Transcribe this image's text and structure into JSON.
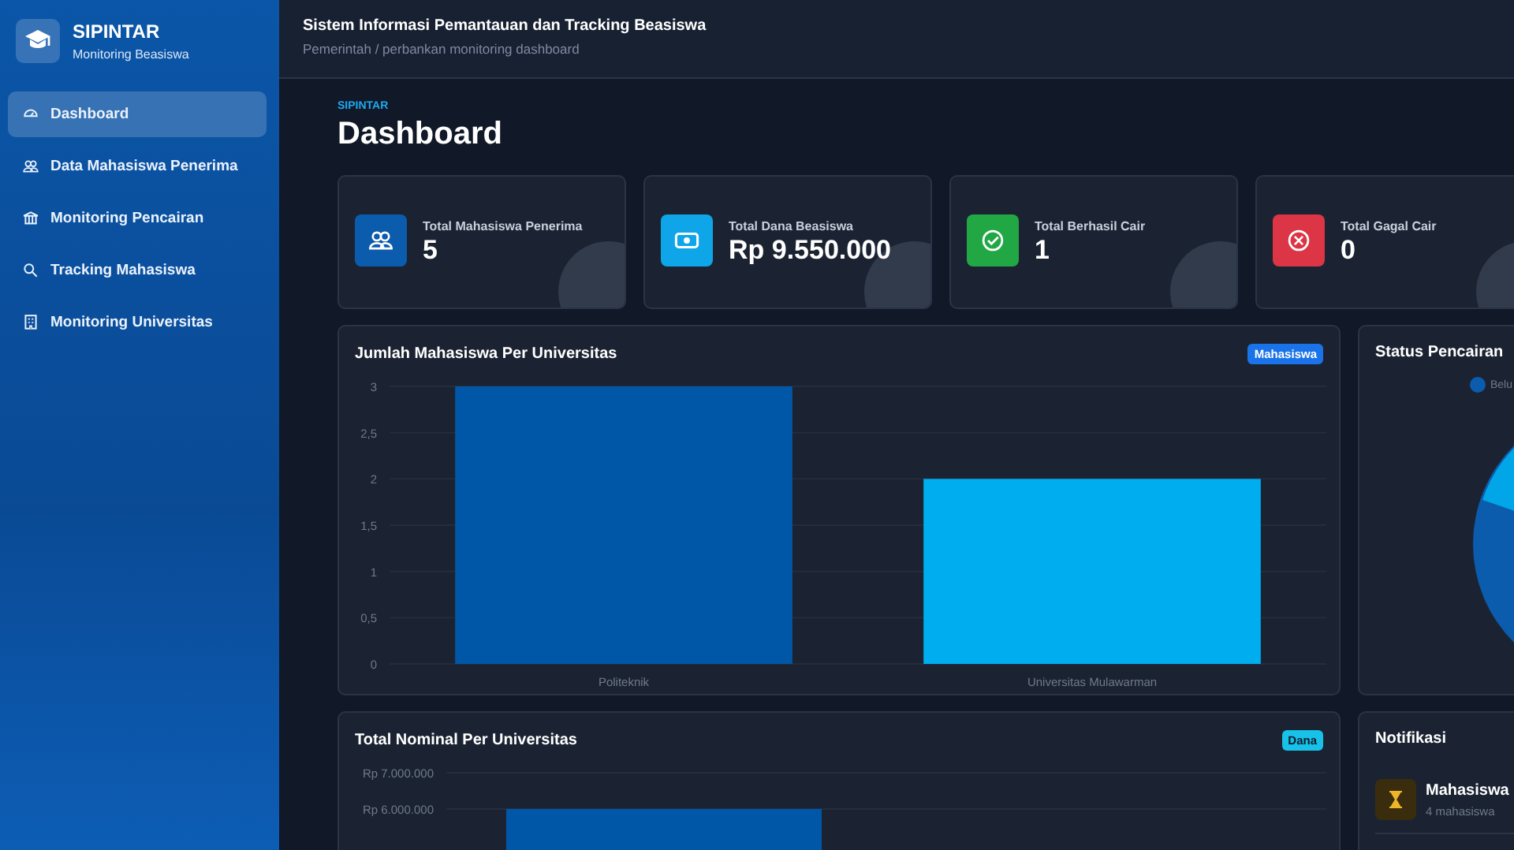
{
  "sidebar": {
    "brand": {
      "title": "SIPINTAR",
      "subtitle": "Monitoring Beasiswa"
    },
    "items": [
      {
        "label": "Dashboard",
        "selected": true
      },
      {
        "label": "Data Mahasiswa Penerima",
        "selected": false
      },
      {
        "label": "Monitoring Pencairan",
        "selected": false
      },
      {
        "label": "Tracking Mahasiswa",
        "selected": false
      },
      {
        "label": "Monitoring Universitas",
        "selected": false
      }
    ]
  },
  "topbar": {
    "title": "Sistem Informasi Pemantauan dan Tracking Beasiswa",
    "subtitle": "Pemerintah / perbankan monitoring dashboard"
  },
  "page": {
    "eyebrow": "SIPINTAR",
    "title": "Dashboard"
  },
  "stats": [
    {
      "label": "Total Mahasiswa Penerima",
      "value": "5",
      "color": "#0b5cad"
    },
    {
      "label": "Total Dana Beasiswa",
      "value": "Rp 9.550.000",
      "color": "#0ea5e9"
    },
    {
      "label": "Total Berhasil Cair",
      "value": "1",
      "color": "#22a745"
    },
    {
      "label": "Total Gagal Cair",
      "value": "0",
      "color": "#dc3545"
    }
  ],
  "student_chart": {
    "title": "Jumlah Mahasiswa Per Universitas",
    "badge": "Mahasiswa",
    "chart_data": {
      "type": "bar",
      "categories": [
        "Politeknik",
        "Universitas Mulawarman"
      ],
      "values": [
        3,
        2
      ],
      "ylim": [
        0,
        3
      ],
      "grid": true,
      "yticks": [
        0,
        {
          "value": 0.5,
          "label": "0,5"
        },
        1,
        {
          "value": 1.5,
          "label": "1,5"
        },
        2,
        {
          "value": 2.5,
          "label": "2,5"
        },
        3
      ]
    }
  },
  "status_chart": {
    "title": "Status Pencairan",
    "legend": [
      {
        "label": "Belu",
        "color": "#0b5cad"
      }
    ]
  },
  "nominal_chart": {
    "title": "Total Nominal Per Universitas",
    "badge": "Dana",
    "axis_labels": [
      "Rp 7.000.000",
      "Rp 6.000.000"
    ]
  },
  "notifications": {
    "title": "Notifikasi",
    "items": [
      {
        "title": "Mahasiswa",
        "subtitle": "4 mahasiswa"
      }
    ]
  }
}
